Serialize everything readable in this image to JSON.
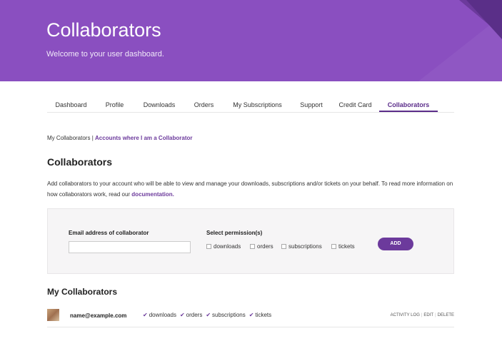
{
  "hero": {
    "title": "Collaborators",
    "subtitle": "Welcome to your user dashboard."
  },
  "tabs": [
    {
      "label": "Dashboard"
    },
    {
      "label": "Profile"
    },
    {
      "label": "Downloads"
    },
    {
      "label": "Orders"
    },
    {
      "label": "My Subscriptions"
    },
    {
      "label": "Support"
    },
    {
      "label": "Credit Card"
    },
    {
      "label": "Collaborators"
    }
  ],
  "active_tab": "Collaborators",
  "subnav": {
    "current": "My Collaborators",
    "separator": "|",
    "link": "Accounts where I am a Collaborator"
  },
  "section": {
    "title": "Collaborators",
    "description": "Add collaborators to your account who will be able to view and manage your downloads, subscriptions and/or tickets on your behalf. To read more information on how collaborators work, read our",
    "doc_link": "documentation."
  },
  "form": {
    "email_label": "Email address of collaborator",
    "email_value": "",
    "permissions_label": "Select permission(s)",
    "permissions": [
      "downloads",
      "orders",
      "subscriptions",
      "tickets"
    ],
    "add_label": "ADD"
  },
  "my_collaborators": {
    "title": "My Collaborators",
    "rows": [
      {
        "email": "name@example.com",
        "permissions": [
          "downloads",
          "orders",
          "subscriptions",
          "tickets"
        ],
        "actions": [
          "ACTIVITY LOG",
          "EDIT",
          "DELETE"
        ]
      }
    ]
  },
  "colors": {
    "brand": "#8a4fc0",
    "accent": "#6c3a9c"
  },
  "icons": {
    "check": "check-icon"
  }
}
